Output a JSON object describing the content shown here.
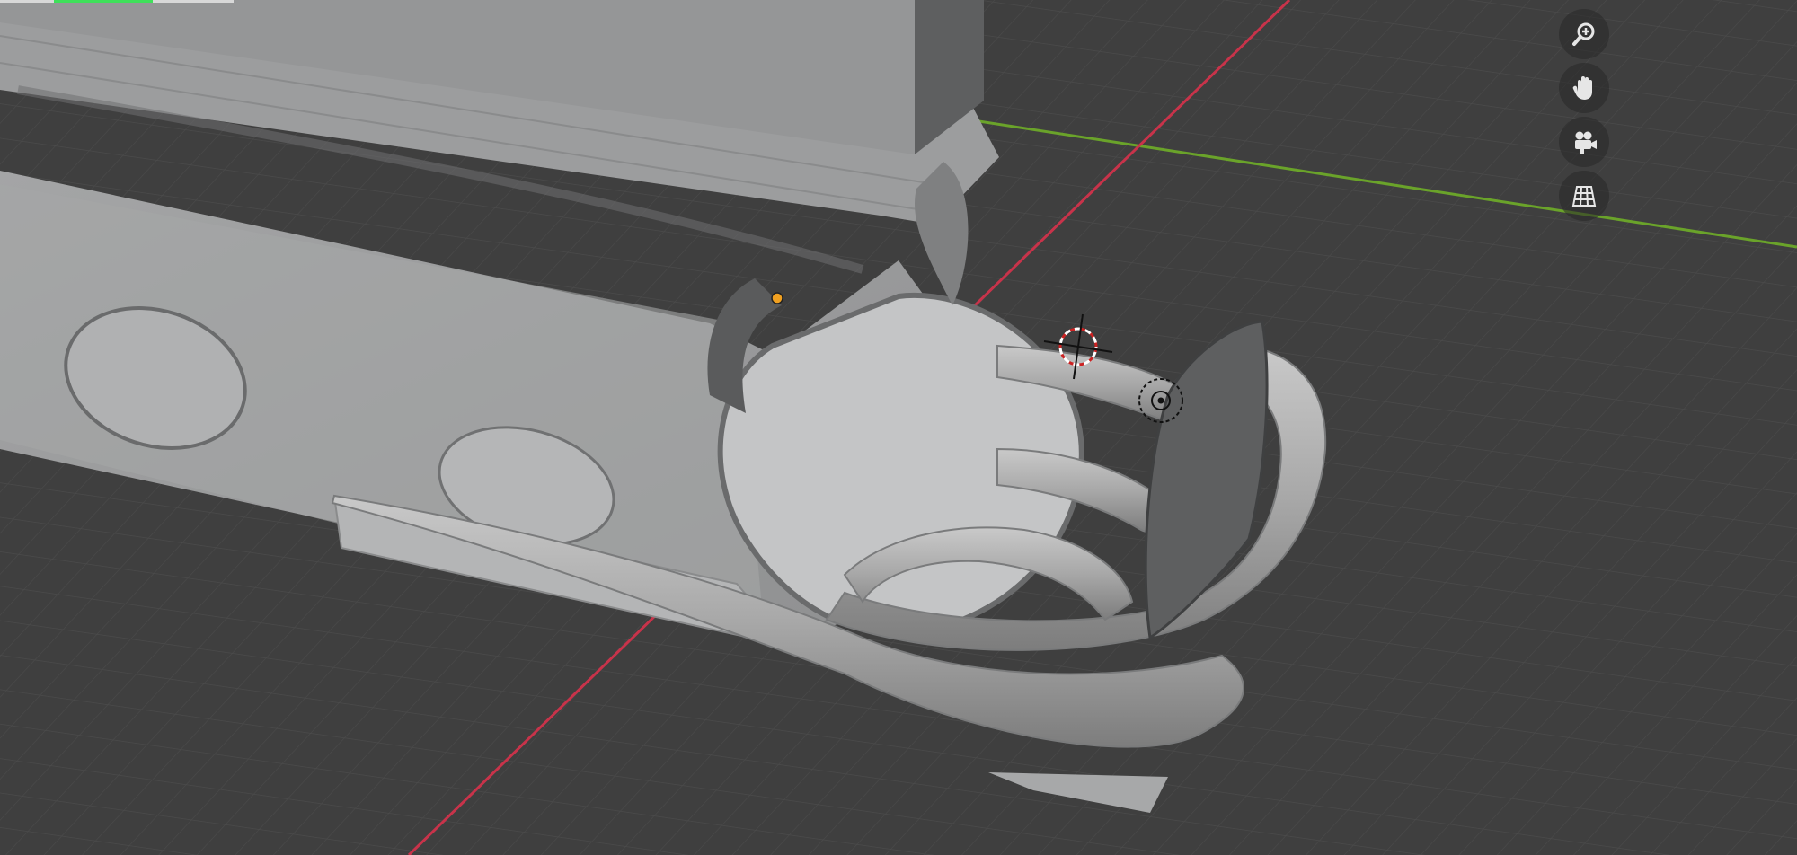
{
  "viewport": {
    "name": "3D Viewport",
    "background_color": "#3f3f3f",
    "grid_color": "#4a4a4a",
    "x_axis_color": "#c8334a",
    "y_axis_color": "#6aa32a",
    "object_color": "#9a9b9c"
  },
  "progress": {
    "fraction": 0.55,
    "fill_color": "#3fe05a"
  },
  "navigation_gizmo": {
    "buttons": [
      {
        "id": "zoom",
        "icon": "zoom-in-icon"
      },
      {
        "id": "pan",
        "icon": "hand-icon"
      },
      {
        "id": "camera",
        "icon": "camera-icon"
      },
      {
        "id": "projection",
        "icon": "grid-perspective-icon"
      }
    ]
  },
  "overlays": {
    "origin_point_color": "#f0a020",
    "cursor_color": "#cc2222"
  }
}
